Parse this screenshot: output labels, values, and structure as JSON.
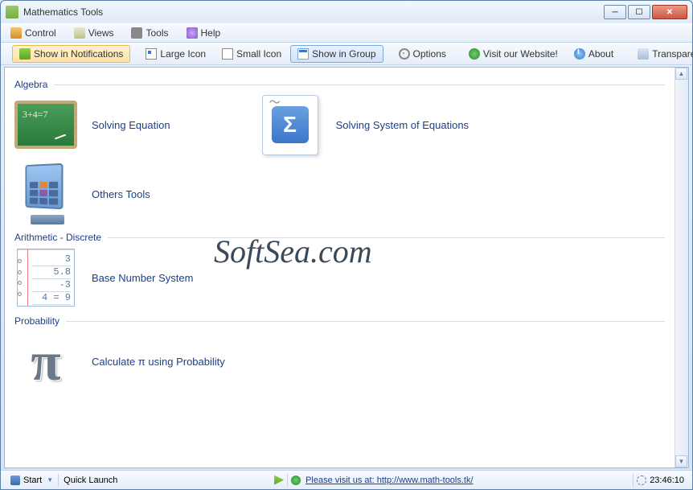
{
  "window": {
    "title": "Mathematics Tools"
  },
  "menu": {
    "control": "Control",
    "views": "Views",
    "tools": "Tools",
    "help": "Help"
  },
  "toolbar": {
    "notifications": "Show in Notifications",
    "large_icon": "Large Icon",
    "small_icon": "Small Icon",
    "show_group": "Show in Group",
    "options": "Options",
    "visit": "Visit our Website!",
    "about": "About",
    "transparency": "Transparency"
  },
  "groups": {
    "algebra": {
      "title": "Algebra",
      "items": {
        "solve_eq": "Solving Equation",
        "solve_sys": "Solving System of Equations",
        "others": "Others Tools"
      },
      "chalkboard_text": "3+4=7"
    },
    "arithmetic": {
      "title": "Arithmetic - Discrete",
      "items": {
        "base_num": "Base Number System"
      },
      "notebook_lines": [
        "3",
        "5.8",
        "-3",
        "4 = 9"
      ]
    },
    "probability": {
      "title": "Probability",
      "items": {
        "calc_pi": "Calculate π using Probability"
      }
    }
  },
  "watermark": "SoftSea.com",
  "statusbar": {
    "start": "Start",
    "quick_launch": "Quick Launch",
    "link_prefix": "Please visit us at: ",
    "link_url": "http://www.math-tools.tk/",
    "clock": "23:46:10"
  }
}
